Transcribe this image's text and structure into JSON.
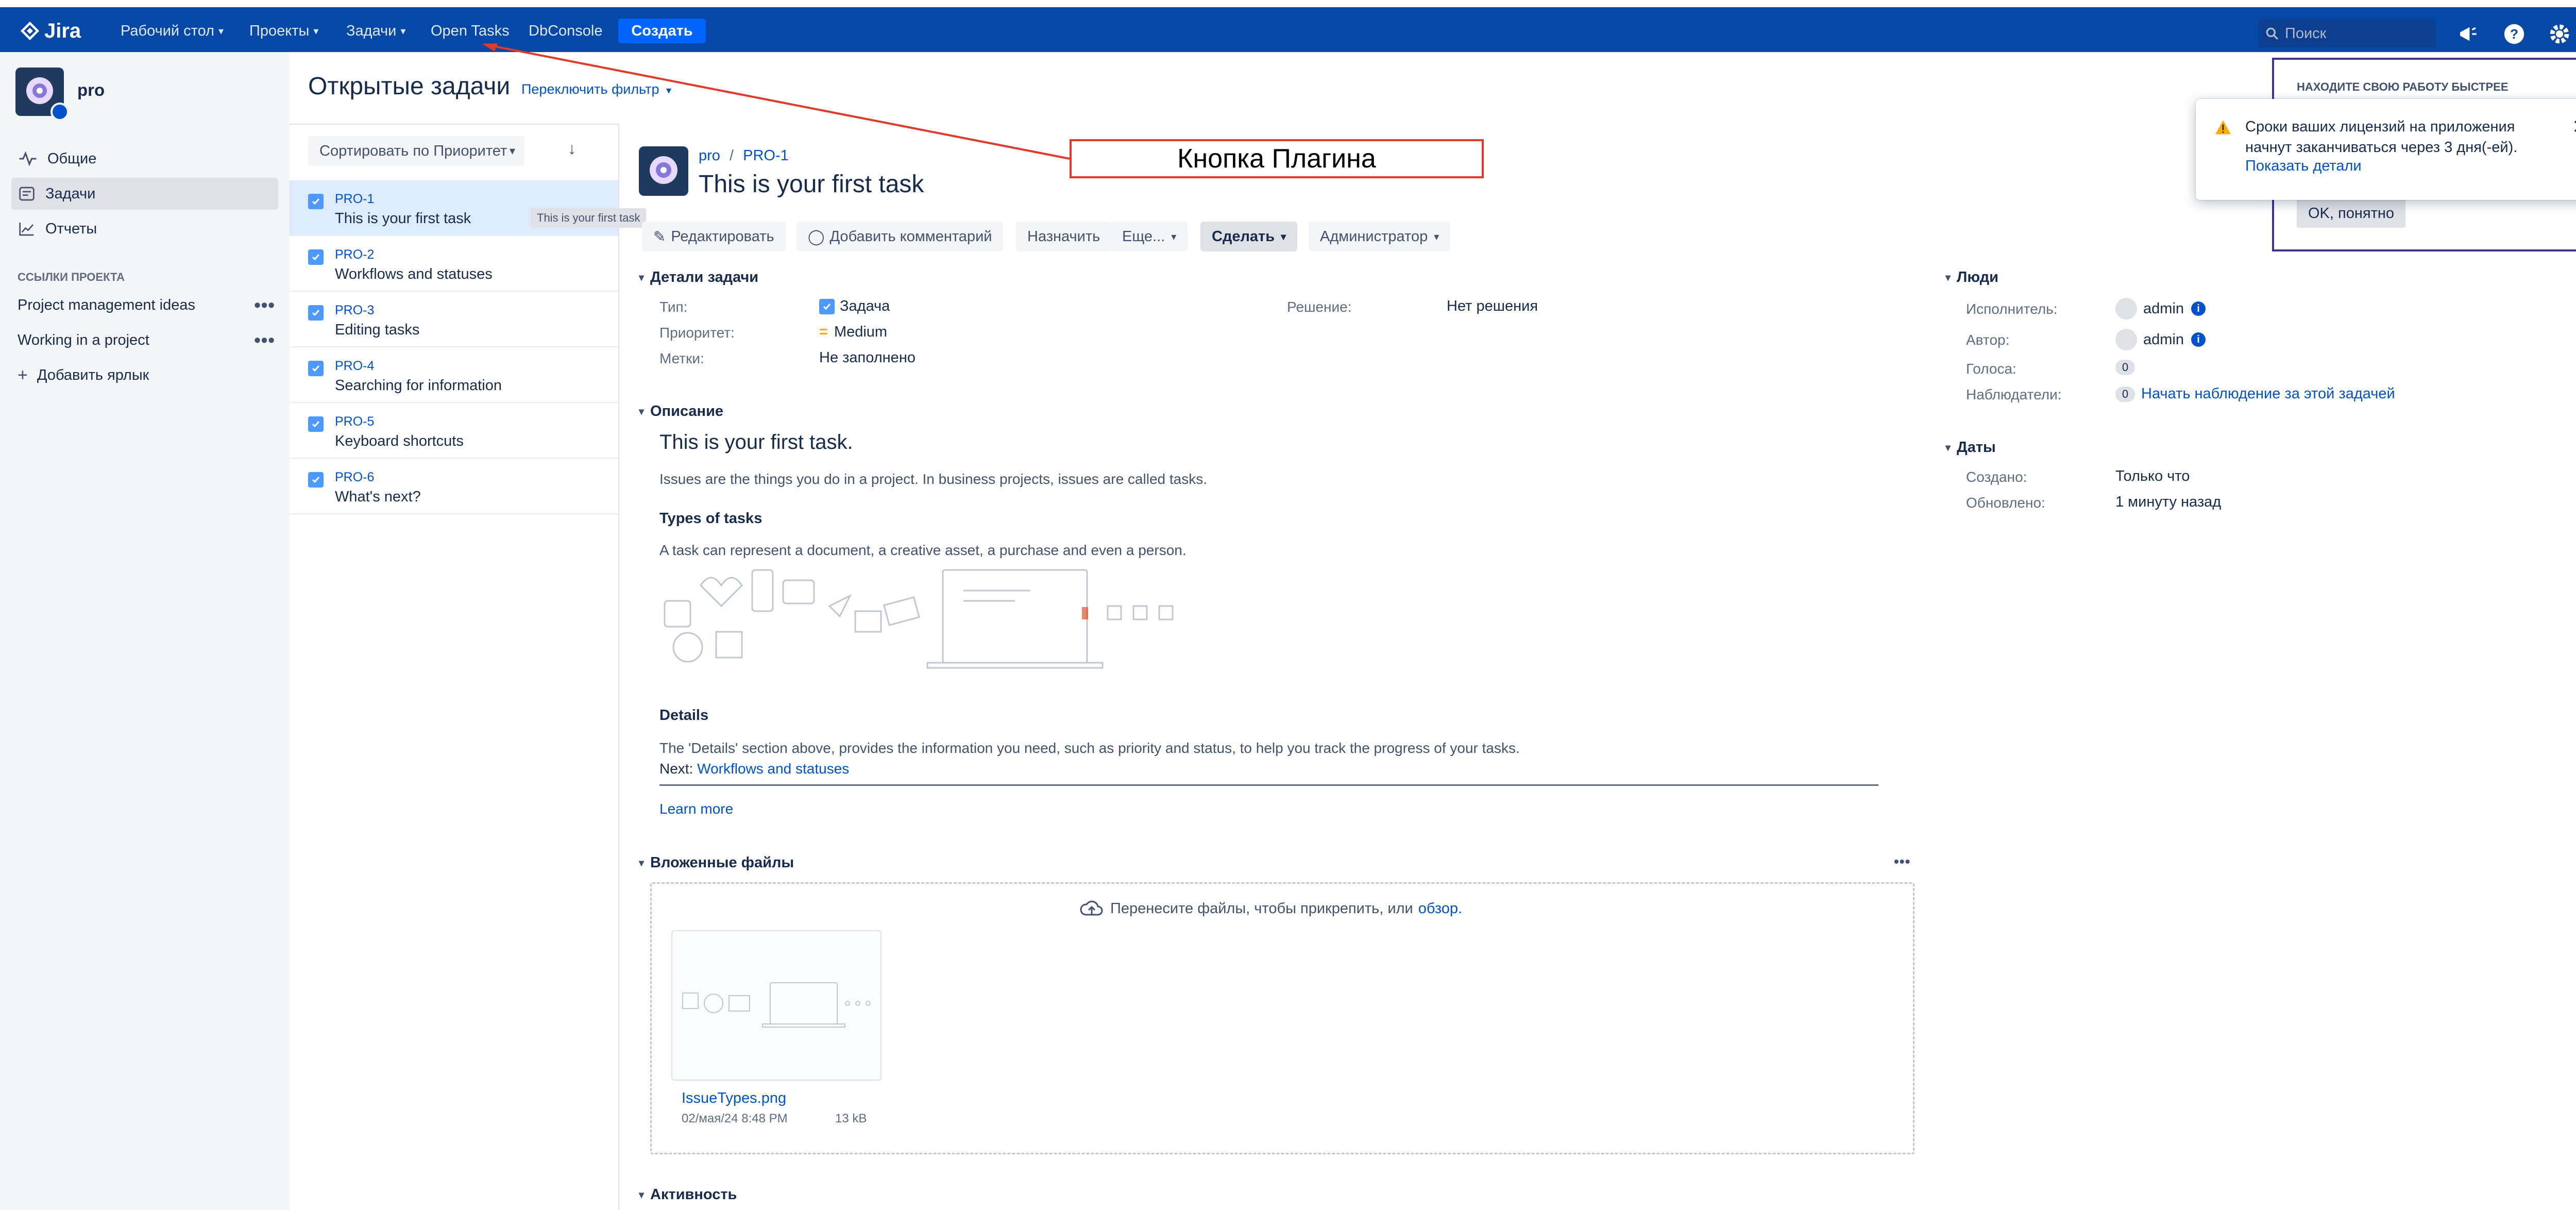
{
  "topbar": {
    "logo": "Jira",
    "nav": [
      {
        "label": "Рабочий стол",
        "dropdown": true
      },
      {
        "label": "Проекты",
        "dropdown": true
      },
      {
        "label": "Задачи",
        "dropdown": true
      },
      {
        "label": "Open Tasks",
        "dropdown": false
      },
      {
        "label": "DbConsole",
        "dropdown": false
      }
    ],
    "create_label": "Создать",
    "search_placeholder": "Поиск",
    "icons": [
      "notifications-icon",
      "help-icon",
      "settings-icon",
      "user-avatar"
    ]
  },
  "sidebar": {
    "project_name": "pro",
    "items": [
      {
        "label": "Общие",
        "icon": "activity-icon",
        "active": false
      },
      {
        "label": "Задачи",
        "icon": "issues-icon",
        "active": true
      },
      {
        "label": "Отчеты",
        "icon": "reports-icon",
        "active": false
      }
    ],
    "links_section_title": "ССЫЛКИ ПРОЕКТА",
    "links": [
      {
        "label": "Project management ideas"
      },
      {
        "label": "Working in a project"
      }
    ],
    "add_shortcut": "Добавить ярлык"
  },
  "header": {
    "title": "Открытые задачи",
    "switch_filter": "Переключить фильтр"
  },
  "list": {
    "sort_label": "Сортировать по Приоритет",
    "sort_dir": "↓",
    "issues": [
      {
        "key": "PRO-1",
        "summary": "This is your first task",
        "selected": true
      },
      {
        "key": "PRO-2",
        "summary": "Workflows and statuses",
        "selected": false
      },
      {
        "key": "PRO-3",
        "summary": "Editing tasks",
        "selected": false
      },
      {
        "key": "PRO-4",
        "summary": "Searching for information",
        "selected": false
      },
      {
        "key": "PRO-5",
        "summary": "Keyboard shortcuts",
        "selected": false
      },
      {
        "key": "PRO-6",
        "summary": "What's next?",
        "selected": false
      }
    ],
    "tooltip": "This is your first task"
  },
  "issue": {
    "breadcrumb_project": "pro",
    "breadcrumb_sep": "/",
    "breadcrumb_key": "PRO-1",
    "title": "This is your first task",
    "actions": {
      "edit": "Редактировать",
      "comment": "Добавить комментарий",
      "assign": "Назначить",
      "more": "Еще...",
      "do": "Сделать",
      "admin": "Администратор"
    },
    "details_title": "Детали задачи",
    "fields": {
      "type_label": "Тип:",
      "type_value": "Задача",
      "priority_label": "Приоритет:",
      "priority_value": "Medium",
      "labels_label": "Метки:",
      "labels_value": "Не заполнено",
      "resolution_label": "Решение:",
      "resolution_value": "Нет решения"
    },
    "description_title": "Описание",
    "description": {
      "heading": "This is your first task.",
      "intro": "Issues are the things you do in a project. In business projects, issues are called tasks.",
      "types_heading": "Types of tasks",
      "types_text": "A task can represent a document, a creative asset, a purchase and even a person.",
      "details_heading": "Details",
      "details_text": "The 'Details' section above, provides the information you need, such as priority and status, to help you track the progress of your tasks.",
      "next_label": "Next:",
      "next_link": "Workflows and statuses",
      "learn_more": "Learn more"
    },
    "attachments_title": "Вложенные файлы",
    "attachments": {
      "drop_text": "Перенесите файлы, чтобы прикрепить, или",
      "browse": "обзор.",
      "file_name": "IssueTypes.png",
      "file_date": "02/мая/24 8:48 PM",
      "file_size": "13 kB"
    },
    "activity_title": "Активность"
  },
  "people": {
    "title": "Люди",
    "assignee_label": "Исполнитель:",
    "assignee": "admin",
    "reporter_label": "Автор:",
    "reporter": "admin",
    "votes_label": "Голоса:",
    "votes": "0",
    "watchers_label": "Наблюдатели:",
    "watchers": "0",
    "watch_link": "Начать наблюдение за этой задачей"
  },
  "dates": {
    "title": "Даты",
    "created_label": "Создано:",
    "created": "Только что",
    "updated_label": "Обновлено:",
    "updated": "1 минуту назад"
  },
  "onboarding": {
    "title": "НАХОДИТЕ СВОЮ РАБОТУ БЫСТРЕЕ",
    "ok": "OK, понятно"
  },
  "notice": {
    "text": "Сроки ваших лицензий на приложения начнут заканчиваться через 3 дня(-ей).",
    "link": "Показать детали",
    "close": "✕"
  },
  "annotation": {
    "label": "Кнопка Плагина"
  },
  "colors": {
    "topbar": "#0747a6",
    "create_button": "#0065ff",
    "link": "#0052cc",
    "annotation": "#e03a2a",
    "onboarding_border": "#403294"
  }
}
